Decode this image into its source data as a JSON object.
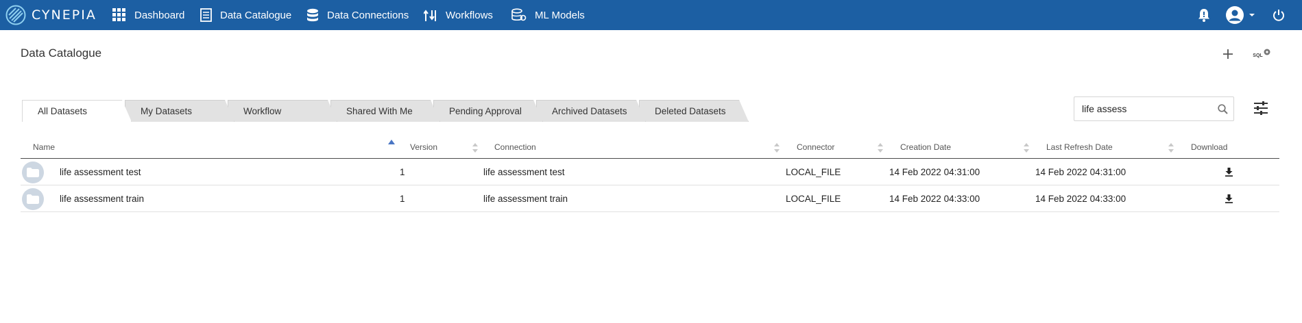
{
  "app": {
    "brand": "CYNEPIA"
  },
  "nav": {
    "items": [
      {
        "label": "Dashboard",
        "icon": "grid-icon"
      },
      {
        "label": "Data Catalogue",
        "icon": "document-icon"
      },
      {
        "label": "Data Connections",
        "icon": "database-icon"
      },
      {
        "label": "Workflows",
        "icon": "workflow-icon"
      },
      {
        "label": "ML Models",
        "icon": "ml-models-icon"
      }
    ]
  },
  "page": {
    "title": "Data Catalogue",
    "sql_label": "SQL"
  },
  "tabs": [
    {
      "label": "All Datasets",
      "active": true
    },
    {
      "label": "My Datasets",
      "active": false
    },
    {
      "label": "Workflow",
      "active": false
    },
    {
      "label": "Shared With Me",
      "active": false
    },
    {
      "label": "Pending Approval",
      "active": false
    },
    {
      "label": "Archived Datasets",
      "active": false
    },
    {
      "label": "Deleted Datasets",
      "active": false
    }
  ],
  "search": {
    "value": "life assess"
  },
  "table": {
    "columns": [
      "Name",
      "Version",
      "Connection",
      "Connector",
      "Creation Date",
      "Last Refresh Date",
      "Download"
    ],
    "rows": [
      {
        "name": "life assessment test",
        "version": "1",
        "connection": "life assessment test",
        "connector": "LOCAL_FILE",
        "created": "14 Feb 2022 04:31:00",
        "refreshed": "14 Feb 2022 04:31:00"
      },
      {
        "name": "life assessment train",
        "version": "1",
        "connection": "life assessment train",
        "connector": "LOCAL_FILE",
        "created": "14 Feb 2022 04:33:00",
        "refreshed": "14 Feb 2022 04:33:00"
      }
    ]
  },
  "colors": {
    "topbar": "#1c5fa3",
    "sort_active": "#4a76c4"
  }
}
